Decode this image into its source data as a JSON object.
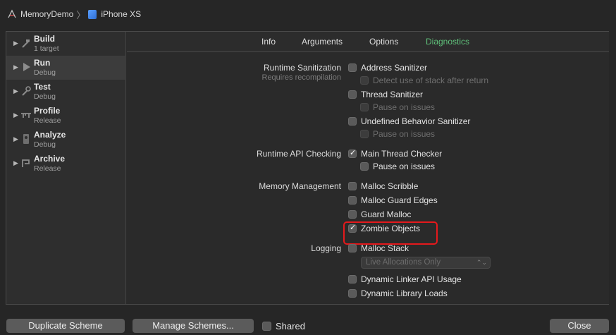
{
  "breadcrumb": {
    "project": "MemoryDemo",
    "device": "iPhone XS"
  },
  "sidebar": {
    "items": [
      {
        "title": "Build",
        "subtitle": "1 target"
      },
      {
        "title": "Run",
        "subtitle": "Debug"
      },
      {
        "title": "Test",
        "subtitle": "Debug"
      },
      {
        "title": "Profile",
        "subtitle": "Release"
      },
      {
        "title": "Analyze",
        "subtitle": "Debug"
      },
      {
        "title": "Archive",
        "subtitle": "Release"
      }
    ]
  },
  "tabs": {
    "info": "Info",
    "arguments": "Arguments",
    "options": "Options",
    "diagnostics": "Diagnostics"
  },
  "sections": {
    "runtime_sanitization": "Runtime Sanitization",
    "requires_recompilation": "Requires recompilation",
    "runtime_api_checking": "Runtime API Checking",
    "memory_management": "Memory Management",
    "logging": "Logging"
  },
  "options": {
    "address_sanitizer": "Address Sanitizer",
    "detect_stack_after_return": "Detect use of stack after return",
    "thread_sanitizer": "Thread Sanitizer",
    "pause_on_issues": "Pause on issues",
    "undefined_behavior_sanitizer": "Undefined Behavior Sanitizer",
    "main_thread_checker": "Main Thread Checker",
    "malloc_scribble": "Malloc Scribble",
    "malloc_guard_edges": "Malloc Guard Edges",
    "guard_malloc": "Guard Malloc",
    "zombie_objects": "Zombie Objects",
    "malloc_stack": "Malloc Stack",
    "malloc_stack_mode": "Live Allocations Only",
    "dynamic_linker_api_usage": "Dynamic Linker API Usage",
    "dynamic_library_loads": "Dynamic Library Loads"
  },
  "buttons": {
    "duplicate_scheme": "Duplicate Scheme",
    "manage_schemes": "Manage Schemes...",
    "shared": "Shared",
    "close": "Close"
  },
  "colors": {
    "accent_tab": "#5fc07a",
    "highlight": "#e5191c"
  }
}
